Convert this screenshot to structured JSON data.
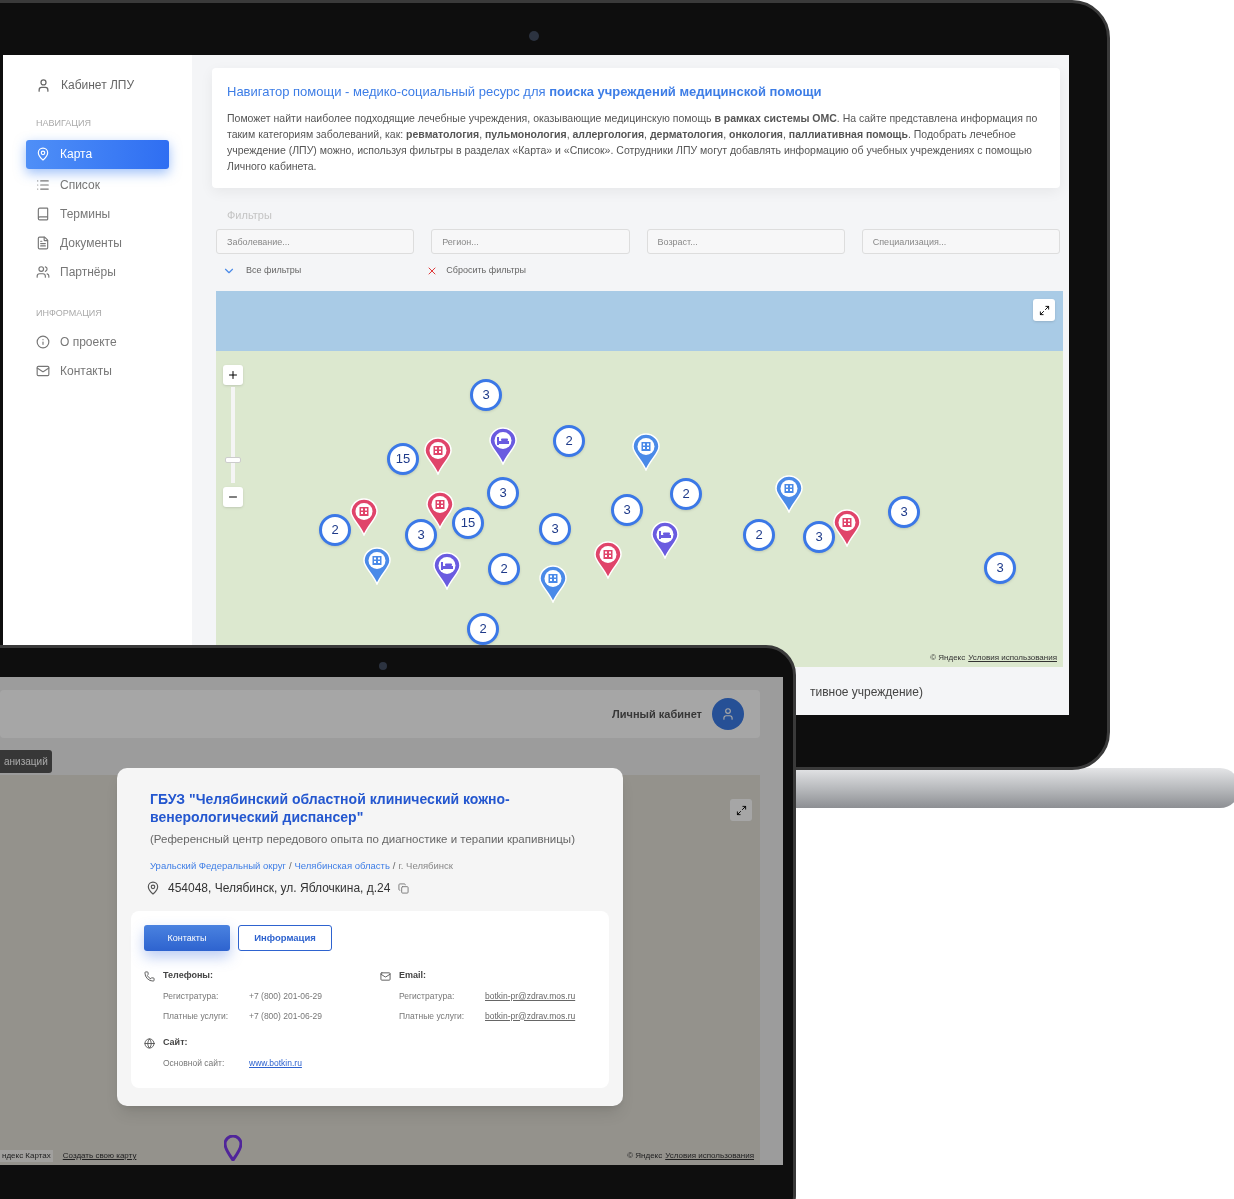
{
  "back_screen": {
    "sidebar": {
      "account_link": "Кабинет ЛПУ",
      "sections": [
        {
          "heading": "НАВИГАЦИЯ",
          "items": [
            {
              "label": "Карта",
              "selected": true
            },
            {
              "label": "Список",
              "selected": false
            },
            {
              "label": "Термины",
              "selected": false
            },
            {
              "label": "Документы",
              "selected": false
            },
            {
              "label": "Партнёры",
              "selected": false
            }
          ]
        },
        {
          "heading": "ИНФОРМАЦИЯ",
          "items": [
            {
              "label": "О проекте",
              "selected": false
            },
            {
              "label": "Контакты",
              "selected": false
            }
          ]
        }
      ]
    },
    "intro": {
      "title": "Навигатор помощи - медико-социальный ресурс для **поиска учреждений медицинской помощи**",
      "text": "Поможет найти наиболее подходящие лечебные учреждения, оказывающие медицинскую помощь **в рамках системы ОМС**. На сайте представлена информация по таким категориям заболеваний, как: **ревматология**, **пульмонология**, **аллергология**, **дерматология**, **онкология**, **паллиативная помощь**. Подобрать лечебное учреждение (ЛПУ) можно, используя фильтры в разделах «Карта» и «Список». Сотрудники ЛПУ могут добавлять информацию об учебных учреждениях с помощью Личного кабинета."
    },
    "filters": {
      "label": "Фильтры",
      "fields": [
        {
          "placeholder": "Заболевание..."
        },
        {
          "placeholder": "Регион..."
        },
        {
          "placeholder": "Возраст..."
        },
        {
          "placeholder": "Специализация..."
        }
      ],
      "all_filters": "Все фильтры",
      "reset": "Сбросить фильтры"
    },
    "map": {
      "zoom": {
        "level": 0.22
      },
      "attribution": "© Яндекс",
      "terms": "Условия использования",
      "markers": [
        {
          "kind": "cluster",
          "label": "3"
        },
        {
          "kind": "cluster",
          "label": "15"
        },
        {
          "kind": "building",
          "color": "#e0446a"
        },
        {
          "kind": "bed",
          "color": "#6a5be0"
        },
        {
          "kind": "cluster",
          "label": "2"
        },
        {
          "kind": "building",
          "color": "#4a8ae8"
        },
        {
          "kind": "building",
          "color": "#e0446a"
        },
        {
          "kind": "building",
          "color": "#e0446a"
        },
        {
          "kind": "cluster",
          "label": "3"
        },
        {
          "kind": "cluster",
          "label": "3"
        },
        {
          "kind": "cluster",
          "label": "2"
        },
        {
          "kind": "building",
          "color": "#4a8ae8"
        },
        {
          "kind": "cluster",
          "label": "3"
        },
        {
          "kind": "cluster",
          "label": "2"
        },
        {
          "kind": "cluster",
          "label": "3"
        },
        {
          "kind": "cluster",
          "label": "15"
        },
        {
          "kind": "cluster",
          "label": "3"
        },
        {
          "kind": "bed",
          "color": "#6a5be0"
        },
        {
          "kind": "cluster",
          "label": "2"
        },
        {
          "kind": "cluster",
          "label": "3"
        },
        {
          "kind": "building",
          "color": "#e0446a"
        },
        {
          "kind": "building",
          "color": "#4a8ae8"
        },
        {
          "kind": "bed",
          "color": "#6a5be0"
        },
        {
          "kind": "cluster",
          "label": "2"
        },
        {
          "kind": "building",
          "color": "#4a8ae8"
        },
        {
          "kind": "building",
          "color": "#e0446a"
        },
        {
          "kind": "cluster",
          "label": "3"
        },
        {
          "kind": "cluster",
          "label": "2"
        }
      ]
    },
    "below_map_text": "тивное учреждение)"
  },
  "front_screen": {
    "header": {
      "account_label": "Личный кабинет"
    },
    "tag": "анизаций",
    "map": {
      "left_credit": "ндекс Картах",
      "create_map_link": "Создать свою карту",
      "attribution": "© Яндекс",
      "terms": "Условия использования"
    },
    "popup": {
      "title": "ГБУЗ \"Челябинский областной клинический кожно-венерологический диспансер\"",
      "subtitle": "(Референсный центр передового опыта по диагностике и терапии крапивницы)",
      "breadcrumb_separator": "/",
      "breadcrumbs": [
        {
          "label": "Уральский Федеральный округ",
          "link": true
        },
        {
          "label": "Челябинская область",
          "link": true
        },
        {
          "label": "г. Челябинск",
          "link": false
        }
      ],
      "address": "454048, Челябинск, ул. Яблочкина, д.24",
      "tabs": [
        {
          "label": "Контакты",
          "selected": true
        },
        {
          "label": "Информация",
          "selected": false
        }
      ],
      "phones": {
        "heading": "Телефоны:",
        "rows": [
          {
            "label": "Регистратура:",
            "value": "+7 (800) 201-06-29"
          },
          {
            "label": "Платные услуги:",
            "value": "+7 (800) 201-06-29"
          }
        ]
      },
      "email": {
        "heading": "Email:",
        "rows": [
          {
            "label": "Регистратура:",
            "value": "botkin-pr@zdrav.mos.ru"
          },
          {
            "label": "Платные услуги:",
            "value": "botkin-pr@zdrav.mos.ru"
          }
        ]
      },
      "site": {
        "heading": "Сайт:",
        "rows": [
          {
            "label": "Основной сайт:",
            "value": "www.botkin.ru"
          }
        ]
      }
    }
  }
}
